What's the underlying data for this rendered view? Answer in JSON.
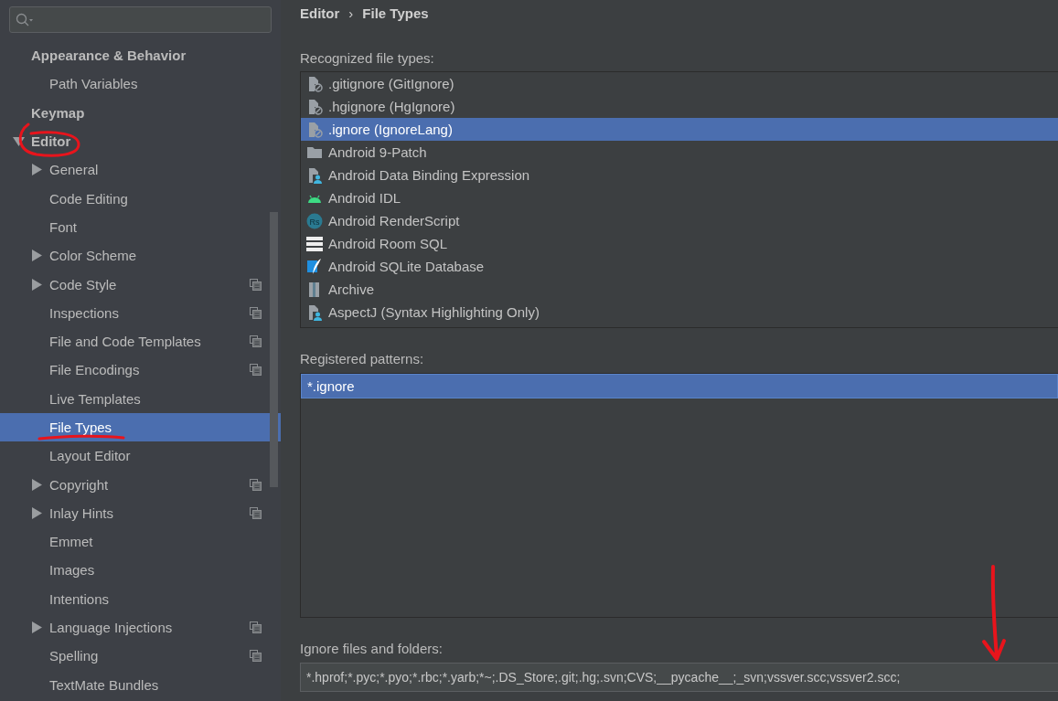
{
  "sidebar": {
    "items": [
      {
        "label": "Appearance & Behavior",
        "selected": false,
        "children": [
          {
            "label": "Path Variables",
            "selected": false
          }
        ]
      },
      {
        "label": "Keymap",
        "selected": false
      },
      {
        "label": "Editor",
        "selected": false,
        "expanded": true,
        "children": [
          {
            "label": "General",
            "selected": false,
            "expanded": false,
            "project_level": false
          },
          {
            "label": "Code Editing",
            "selected": false,
            "project_level": false
          },
          {
            "label": "Font",
            "selected": false,
            "project_level": false
          },
          {
            "label": "Color Scheme",
            "selected": false,
            "expanded": false,
            "project_level": false
          },
          {
            "label": "Code Style",
            "selected": false,
            "expanded": false,
            "project_level": true
          },
          {
            "label": "Inspections",
            "selected": false,
            "project_level": true
          },
          {
            "label": "File and Code Templates",
            "selected": false,
            "project_level": true
          },
          {
            "label": "File Encodings",
            "selected": false,
            "project_level": true
          },
          {
            "label": "Live Templates",
            "selected": false,
            "project_level": false
          },
          {
            "label": "File Types",
            "selected": true,
            "project_level": false
          },
          {
            "label": "Layout Editor",
            "selected": false,
            "project_level": false
          },
          {
            "label": "Copyright",
            "selected": false,
            "expanded": false,
            "project_level": true
          },
          {
            "label": "Inlay Hints",
            "selected": false,
            "expanded": false,
            "project_level": true
          },
          {
            "label": "Emmet",
            "selected": false,
            "project_level": false
          },
          {
            "label": "Images",
            "selected": false,
            "project_level": false
          },
          {
            "label": "Intentions",
            "selected": false,
            "project_level": false
          },
          {
            "label": "Language Injections",
            "selected": false,
            "expanded": false,
            "project_level": true
          },
          {
            "label": "Spelling",
            "selected": false,
            "project_level": true
          },
          {
            "label": "TextMate Bundles",
            "selected": false,
            "project_level": false
          }
        ]
      }
    ]
  },
  "breadcrumb": {
    "parent": "Editor",
    "separator": "›",
    "current": "File Types"
  },
  "file_types": {
    "label": "Recognized file types:",
    "items": [
      {
        "label": ".gitignore (GitIgnore)",
        "kind": "ignore",
        "selected": false
      },
      {
        "label": ".hgignore (HgIgnore)",
        "kind": "ignore",
        "selected": false
      },
      {
        "label": ".ignore (IgnoreLang)",
        "kind": "ignore",
        "selected": true
      },
      {
        "label": "Android 9-Patch",
        "kind": "folder",
        "selected": false
      },
      {
        "label": "Android Data Binding Expression",
        "kind": "custom",
        "selected": false
      },
      {
        "label": "Android IDL",
        "kind": "android",
        "selected": false
      },
      {
        "label": "Android RenderScript",
        "kind": "renderscript",
        "icon_text": "Rs",
        "selected": false
      },
      {
        "label": "Android Room SQL",
        "kind": "room",
        "selected": false
      },
      {
        "label": "Android SQLite Database",
        "kind": "sqlite",
        "selected": false
      },
      {
        "label": "Archive",
        "kind": "archive",
        "selected": false
      },
      {
        "label": "AspectJ (Syntax Highlighting Only)",
        "kind": "custom",
        "selected": false
      }
    ]
  },
  "patterns": {
    "label": "Registered patterns:",
    "items": [
      {
        "label": "*.ignore",
        "selected": true
      }
    ]
  },
  "ignore_files": {
    "label": "Ignore files and folders:",
    "value": "*.hprof;*.pyc;*.pyo;*.rbc;*.yarb;*~;.DS_Store;.git;.hg;.svn;CVS;__pycache__;_svn;vssver.scc;vssver2.scc;"
  }
}
